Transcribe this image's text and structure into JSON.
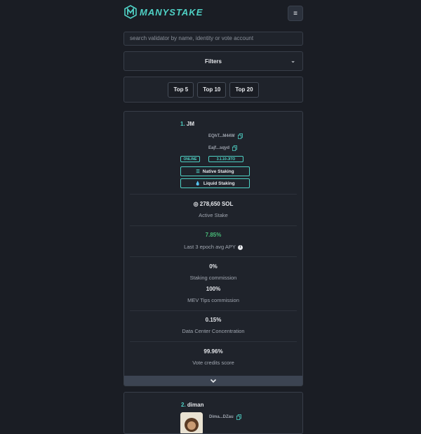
{
  "app": {
    "brand": "MANYSTAKE",
    "menu_icon": "hamburger-icon"
  },
  "search": {
    "placeholder": "search validator by name, identity or vote account"
  },
  "filters": {
    "label": "Filters"
  },
  "top_buttons": [
    "Top 5",
    "Top 10",
    "Top 20"
  ],
  "validators": [
    {
      "rank": "1.",
      "name": "JM",
      "identity": "EQhT...M44W",
      "vote_account": "Eajf...sqyd",
      "status": "ONLINE",
      "version": "3.1.10-JITO",
      "native_label": "Native Staking",
      "liquid_label": "Liquid Staking",
      "active_stake": "◎ 278,650 SOL",
      "active_stake_label": "Active Stake",
      "apy": "7.85%",
      "apy_label": "Last 3 epoch avg APY",
      "staking_commission": "0%",
      "staking_commission_label": "Staking commission",
      "mev_commission": "100%",
      "mev_commission_label": "MEV Tips commission",
      "dc_concentration": "0.15%",
      "dc_concentration_label": "Data Center Concentration",
      "vote_credits": "99.96%",
      "vote_credits_label": "Vote credits score"
    },
    {
      "rank": "2.",
      "name": "diman",
      "identity": "Dima...DZau"
    }
  ],
  "colors": {
    "accent": "#4fd1c5",
    "apy_green": "#48bb78",
    "background": "#1a1d24"
  }
}
